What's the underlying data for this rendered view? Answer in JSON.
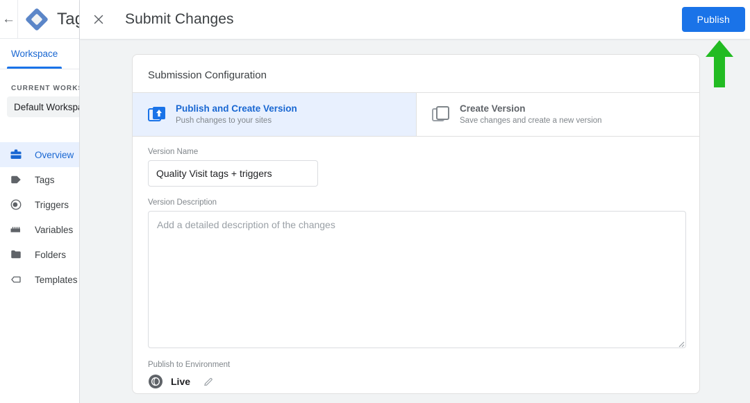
{
  "background_app": {
    "back_icon": "arrow-left-icon",
    "logo": "google-tag-manager-logo",
    "title": "Tag Manager",
    "tabs": [
      {
        "label": "Workspace",
        "selected": true
      }
    ],
    "sidebar": {
      "section_caption": "CURRENT WORKSPACE",
      "workspace_name": "Default Workspace",
      "items": [
        {
          "label": "Overview",
          "icon": "overview-icon",
          "active": true
        },
        {
          "label": "Tags",
          "icon": "tag-icon",
          "active": false
        },
        {
          "label": "Triggers",
          "icon": "trigger-icon",
          "active": false
        },
        {
          "label": "Variables",
          "icon": "variables-icon",
          "active": false
        },
        {
          "label": "Folders",
          "icon": "folder-icon",
          "active": false
        },
        {
          "label": "Templates",
          "icon": "template-icon",
          "active": false
        }
      ]
    }
  },
  "overlay": {
    "close_icon": "close-icon",
    "title": "Submit Changes",
    "publish_button": "Publish",
    "annotation": {
      "icon": "green-up-arrow",
      "color": "#22bb22"
    }
  },
  "card": {
    "title": "Submission Configuration",
    "modes": [
      {
        "name": "Publish and Create Version",
        "subtitle": "Push changes to your sites",
        "icon": "publish-version-icon",
        "selected": true
      },
      {
        "name": "Create Version",
        "subtitle": "Save changes and create a new version",
        "icon": "create-version-icon",
        "selected": false
      }
    ],
    "version_name": {
      "label": "Version Name",
      "value": "Quality Visit tags + triggers",
      "placeholder": ""
    },
    "version_description": {
      "label": "Version Description",
      "value": "",
      "placeholder": "Add a detailed description of the changes"
    },
    "environment": {
      "label": "Publish to Environment",
      "value": "Live",
      "icon": "environment-globe-icon",
      "edit_icon": "pencil-icon"
    }
  },
  "colors": {
    "accent_blue": "#1a73e8",
    "selected_tile_bg": "#e8f0fe",
    "overlay_bg": "#f1f3f4",
    "annotation_green": "#22bb22"
  }
}
